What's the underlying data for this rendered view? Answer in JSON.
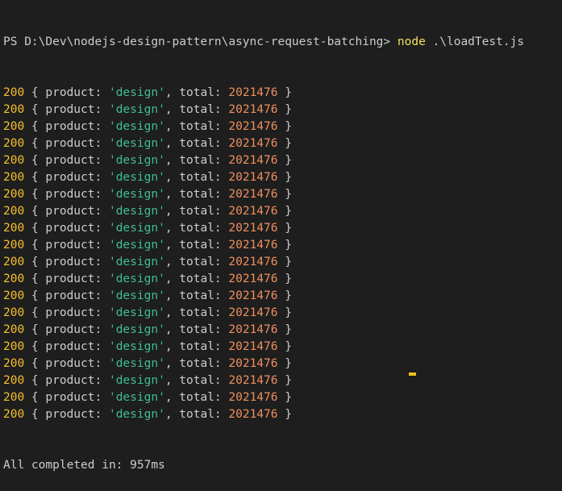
{
  "prompt": {
    "prefix": "PS D:\\Dev\\nodejs-design-pattern\\async-request-batching> ",
    "command": "node",
    "args": " .\\loadTest.js"
  },
  "response_lines": [
    {
      "status": "200",
      "open": " { product: ",
      "product": "'design'",
      "mid": ", total: ",
      "total": "2021476",
      "close": " }"
    },
    {
      "status": "200",
      "open": " { product: ",
      "product": "'design'",
      "mid": ", total: ",
      "total": "2021476",
      "close": " }"
    },
    {
      "status": "200",
      "open": " { product: ",
      "product": "'design'",
      "mid": ", total: ",
      "total": "2021476",
      "close": " }"
    },
    {
      "status": "200",
      "open": " { product: ",
      "product": "'design'",
      "mid": ", total: ",
      "total": "2021476",
      "close": " }"
    },
    {
      "status": "200",
      "open": " { product: ",
      "product": "'design'",
      "mid": ", total: ",
      "total": "2021476",
      "close": " }"
    },
    {
      "status": "200",
      "open": " { product: ",
      "product": "'design'",
      "mid": ", total: ",
      "total": "2021476",
      "close": " }"
    },
    {
      "status": "200",
      "open": " { product: ",
      "product": "'design'",
      "mid": ", total: ",
      "total": "2021476",
      "close": " }"
    },
    {
      "status": "200",
      "open": " { product: ",
      "product": "'design'",
      "mid": ", total: ",
      "total": "2021476",
      "close": " }"
    },
    {
      "status": "200",
      "open": " { product: ",
      "product": "'design'",
      "mid": ", total: ",
      "total": "2021476",
      "close": " }"
    },
    {
      "status": "200",
      "open": " { product: ",
      "product": "'design'",
      "mid": ", total: ",
      "total": "2021476",
      "close": " }"
    },
    {
      "status": "200",
      "open": " { product: ",
      "product": "'design'",
      "mid": ", total: ",
      "total": "2021476",
      "close": " }"
    },
    {
      "status": "200",
      "open": " { product: ",
      "product": "'design'",
      "mid": ", total: ",
      "total": "2021476",
      "close": " }"
    },
    {
      "status": "200",
      "open": " { product: ",
      "product": "'design'",
      "mid": ", total: ",
      "total": "2021476",
      "close": " }"
    },
    {
      "status": "200",
      "open": " { product: ",
      "product": "'design'",
      "mid": ", total: ",
      "total": "2021476",
      "close": " }"
    },
    {
      "status": "200",
      "open": " { product: ",
      "product": "'design'",
      "mid": ", total: ",
      "total": "2021476",
      "close": " }"
    },
    {
      "status": "200",
      "open": " { product: ",
      "product": "'design'",
      "mid": ", total: ",
      "total": "2021476",
      "close": " }"
    },
    {
      "status": "200",
      "open": " { product: ",
      "product": "'design'",
      "mid": ", total: ",
      "total": "2021476",
      "close": " }"
    },
    {
      "status": "200",
      "open": " { product: ",
      "product": "'design'",
      "mid": ", total: ",
      "total": "2021476",
      "close": " }"
    },
    {
      "status": "200",
      "open": " { product: ",
      "product": "'design'",
      "mid": ", total: ",
      "total": "2021476",
      "close": " }"
    },
    {
      "status": "200",
      "open": " { product: ",
      "product": "'design'",
      "mid": ", total: ",
      "total": "2021476",
      "close": " }"
    }
  ],
  "summary": "All completed in: 957ms",
  "colors": {
    "background": "#1e1e1e",
    "text": "#cccccc",
    "command": "#f1e05a",
    "status": "#f5c02b",
    "string": "#3fbf8f",
    "number": "#ef8f5e",
    "cursor": "#f0c020"
  }
}
